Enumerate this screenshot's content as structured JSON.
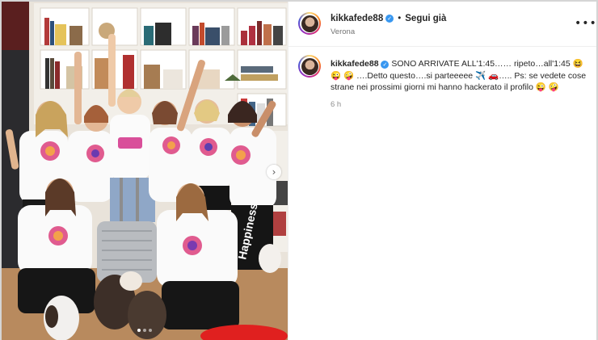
{
  "post": {
    "username": "kikkafede88",
    "follow_label": "Segui già",
    "separator": "•",
    "location": "Verona",
    "more_label": "•••",
    "caption": "SONO ARRIVATE ALL'1:45…… ripeto…all'1:45 😆 😜 🤪 ….Detto questo….si parteeeee ✈️ 🚗….. Ps: se vedete cose strane nei prossimi giorni mi hanno hackerato il profilo 😜 🤪",
    "time_ago": "6 h"
  },
  "media": {
    "shirt_text_1": "Happiness",
    "next_icon": "chevron-right-icon",
    "slide_count": 3,
    "active_slide": 1
  },
  "colors": {
    "verified": "#3897f0",
    "text": "#262626",
    "muted": "#737373"
  }
}
